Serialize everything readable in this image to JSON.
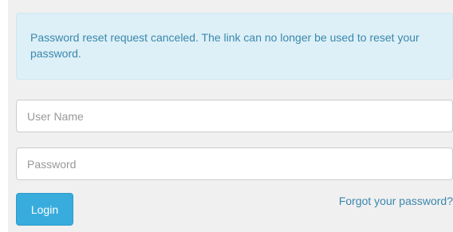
{
  "alert": {
    "message": "Password reset request canceled. The link can no longer be used to reset your password."
  },
  "form": {
    "username_placeholder": "User Name",
    "username_value": "",
    "password_placeholder": "Password",
    "password_value": "",
    "login_label": "Login",
    "forgot_label": "Forgot your password?"
  },
  "colors": {
    "alert_background": "#ddf0f7",
    "alert_text": "#3a87ad",
    "button_primary": "#39acde",
    "link": "#3a87ad"
  }
}
